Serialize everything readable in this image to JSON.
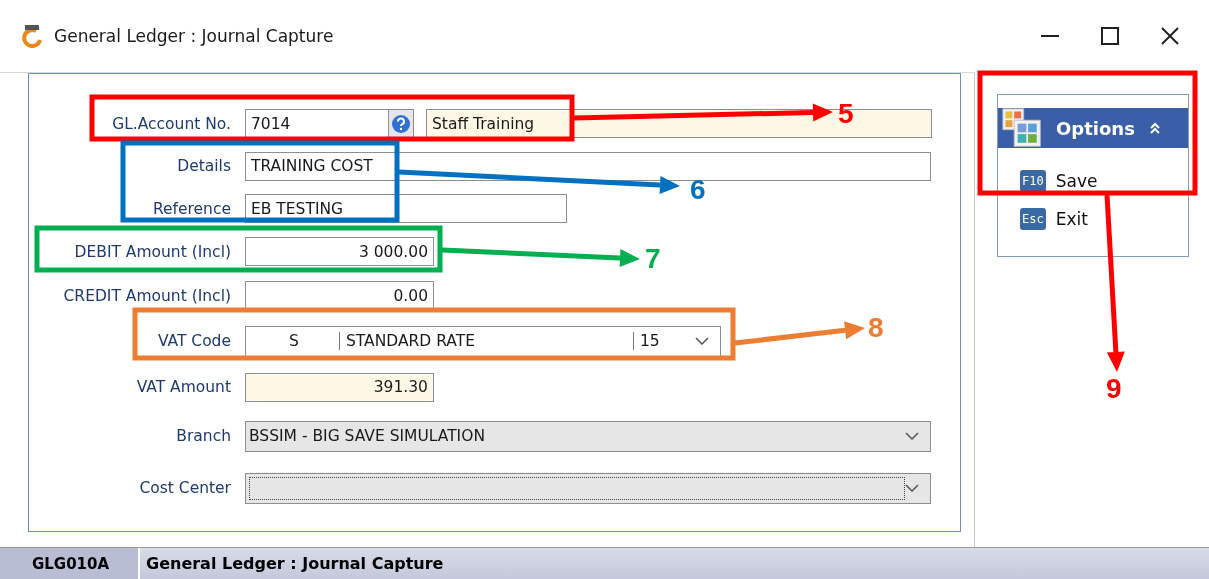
{
  "window": {
    "title": "General Ledger : Journal Capture"
  },
  "form": {
    "account": {
      "label": "GL.Account No.",
      "value": "7014",
      "description": "Staff Training"
    },
    "details": {
      "label": "Details",
      "value": "TRAINING COST"
    },
    "reference": {
      "label": "Reference",
      "value": "EB TESTING"
    },
    "debit": {
      "label": "DEBIT Amount (Incl)",
      "value": "3 000.00"
    },
    "credit": {
      "label": "CREDIT Amount (Incl)",
      "value": "0.00"
    },
    "vat_code": {
      "label": "VAT Code",
      "code": "S",
      "description": "STANDARD RATE",
      "rate": "15"
    },
    "vat_amount": {
      "label": "VAT Amount",
      "value": "391.30"
    },
    "branch": {
      "label": "Branch",
      "value": "BSSIM - BIG SAVE SIMULATION"
    },
    "cost_center": {
      "label": "Cost Center",
      "focused": true
    }
  },
  "options": {
    "title": "Options",
    "expanded": true,
    "items": [
      {
        "key": "F10",
        "label": "Save"
      },
      {
        "key": "Esc",
        "label": "Exit"
      }
    ]
  },
  "status_bar": {
    "code": "GLG010A",
    "title": "General Ledger : Journal Capture"
  },
  "annotations": [
    {
      "number": "5",
      "color": "#ff0000"
    },
    {
      "number": "6",
      "color": "#0070c0"
    },
    {
      "number": "7",
      "color": "#00b050"
    },
    {
      "number": "8",
      "color": "#ed7d31"
    },
    {
      "number": "9",
      "color": "#ff0000"
    }
  ]
}
